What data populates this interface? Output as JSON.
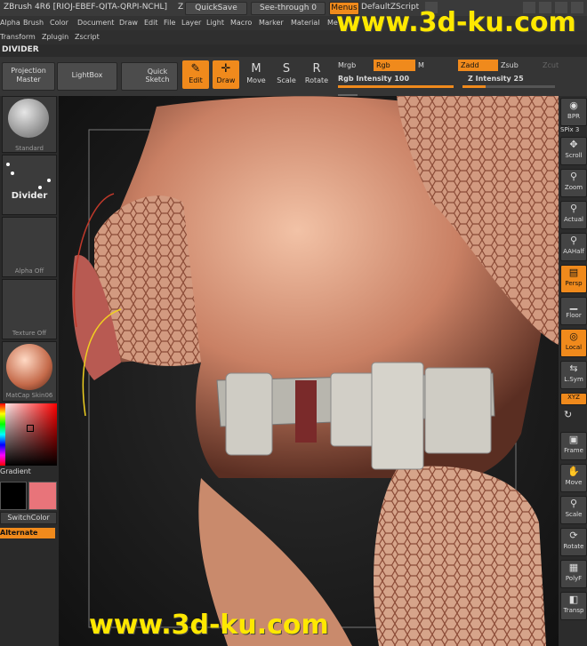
{
  "title": {
    "app": "ZBrush 4R6 [RIOJ-EBEF-QITA-QRPI-NCHL]",
    "z": "Z",
    "quicksave": "QuickSave",
    "seethrough": "See-through 0",
    "menus": "Menus",
    "zscript": "DefaultZScript"
  },
  "menu_row1": [
    "Alpha",
    "Brush",
    "Color",
    "Document",
    "Draw",
    "Edit",
    "File",
    "Layer",
    "Light",
    "Macro",
    "Marker",
    "Material",
    "Me"
  ],
  "menu_row2": [
    "Transform",
    "Zplugin",
    "Zscript"
  ],
  "divider_title": "DIVIDER",
  "toolbar": {
    "projection_master": "Projection Master",
    "lightbox": "LightBox",
    "quick_sketch": "Quick Sketch",
    "edit": "Edit",
    "draw": "Draw",
    "move": "Move",
    "scale": "Scale",
    "rotate": "Rotate",
    "mrgb": "Mrgb",
    "rgb": "Rgb",
    "m": "M",
    "zadd": "Zadd",
    "zsub": "Zsub",
    "zcut": "Zcut",
    "rgb_intensity": "Rgb Intensity 100",
    "z_intensity": "Z Intensity 25",
    "rgb_intensity_value": 100,
    "z_intensity_value": 25
  },
  "left_tray": {
    "brush_label": "Standard",
    "stroke_label": "Divider",
    "alpha_label": "Alpha Off",
    "texture_label": "Texture Off",
    "material_label": "MatCap Skin06",
    "gradient_label": "Gradient",
    "switchcolor_label": "SwitchColor",
    "alternate_label": "Alternate",
    "secondary_color": "#e8747a"
  },
  "right_tray": [
    {
      "label": "BPR",
      "icon": "bpr-icon",
      "on": false
    },
    {
      "label": "SPix 3",
      "icon": "spix-icon",
      "on": false
    },
    {
      "label": "Scroll",
      "icon": "scroll-icon",
      "on": false
    },
    {
      "label": "Zoom",
      "icon": "zoom-icon",
      "on": false
    },
    {
      "label": "Actual",
      "icon": "actual-icon",
      "on": false
    },
    {
      "label": "AAHalf",
      "icon": "aahalf-icon",
      "on": false
    },
    {
      "label": "Persp",
      "icon": "persp-icon",
      "on": true
    },
    {
      "label": "Floor",
      "icon": "floor-icon",
      "on": false
    },
    {
      "label": "Local",
      "icon": "local-icon",
      "on": true
    },
    {
      "label": "L.Sym",
      "icon": "lsym-icon",
      "on": false
    },
    {
      "label": "XYZ",
      "icon": "xyz-icon",
      "on": true
    },
    {
      "label": "Frame",
      "icon": "frame-icon",
      "on": false
    },
    {
      "label": "Move",
      "icon": "move-icon",
      "on": false
    },
    {
      "label": "Scale",
      "icon": "scale-icon",
      "on": false
    },
    {
      "label": "Rotate",
      "icon": "rotate-icon",
      "on": false
    },
    {
      "label": "PolyF",
      "icon": "polyf-icon",
      "on": false
    },
    {
      "label": "Transp",
      "icon": "transp-icon",
      "on": false
    }
  ],
  "watermark": "www.3d-ku.com"
}
